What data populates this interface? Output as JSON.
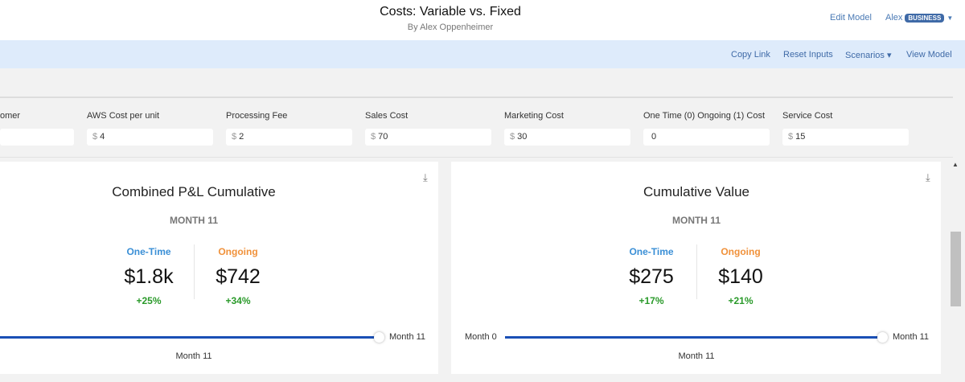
{
  "header": {
    "title": "Costs: Variable vs. Fixed",
    "author": "By Alex Oppenheimer",
    "edit_model": "Edit Model",
    "user": "Alex",
    "plan_badge": "BUSINESS"
  },
  "toolbar": {
    "copy_link": "Copy Link",
    "reset_inputs": "Reset Inputs",
    "scenarios": "Scenarios ▾",
    "view_model": "View Model"
  },
  "inputs": [
    {
      "label": "omer",
      "currency": "",
      "value": ""
    },
    {
      "label": "AWS Cost per unit",
      "currency": "$",
      "value": "4"
    },
    {
      "label": "Processing Fee",
      "currency": "$",
      "value": "2"
    },
    {
      "label": "Sales Cost",
      "currency": "$",
      "value": "70"
    },
    {
      "label": "Marketing Cost",
      "currency": "$",
      "value": "30"
    },
    {
      "label": "One Time (0) Ongoing (1) Cost",
      "currency": "",
      "value": "0"
    },
    {
      "label": "Service Cost",
      "currency": "$",
      "value": "15"
    }
  ],
  "cards": [
    {
      "title": "Combined P&L Cumulative",
      "month": "MONTH 11",
      "one_time_label": "One-Time",
      "one_time_value": "$1.8k",
      "one_time_change": "+25%",
      "ongoing_label": "Ongoing",
      "ongoing_value": "$742",
      "ongoing_change": "+34%",
      "slider_start": "",
      "slider_end": "Month 11",
      "slider_value": "Month 11",
      "slider_fraction": 1.0
    },
    {
      "title": "Cumulative Value",
      "month": "MONTH 11",
      "one_time_label": "One-Time",
      "one_time_value": "$275",
      "one_time_change": "+17%",
      "ongoing_label": "Ongoing",
      "ongoing_value": "$140",
      "ongoing_change": "+21%",
      "slider_start": "Month 0",
      "slider_end": "Month 11",
      "slider_value": "Month 11",
      "slider_fraction": 1.0
    }
  ],
  "colors": {
    "one_time": "#3a8fd6",
    "ongoing": "#f0913a",
    "positive": "#2a9a2a",
    "accent": "#1a4fb5"
  }
}
